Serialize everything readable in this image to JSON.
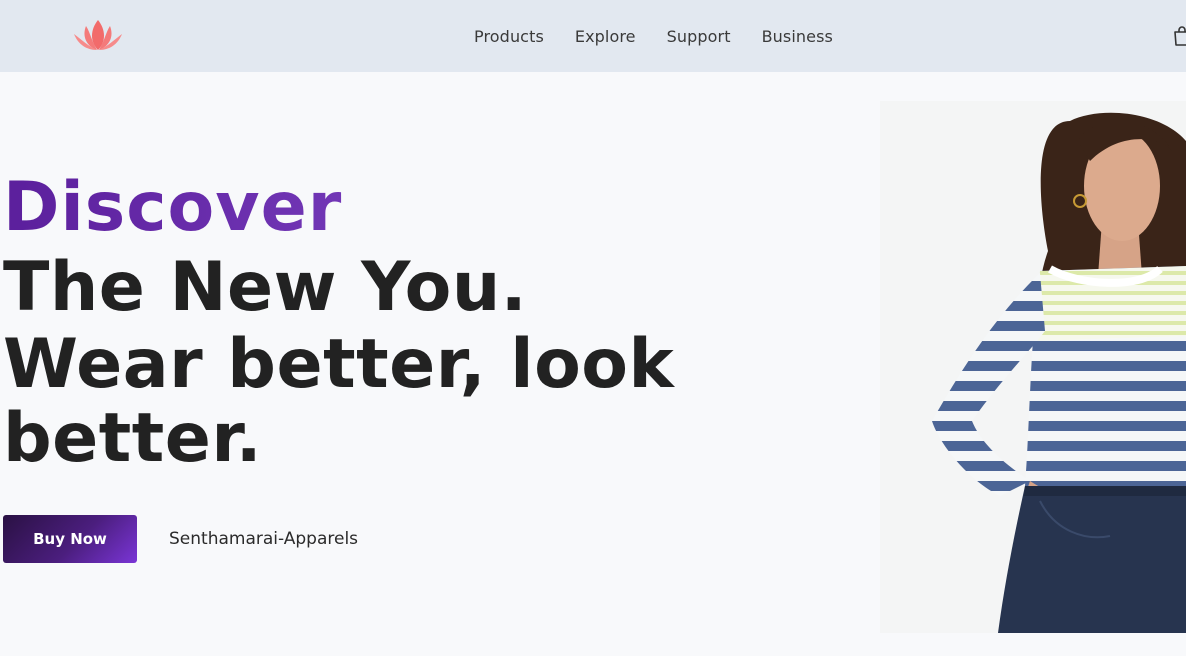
{
  "nav": {
    "logo": "lotus-logo",
    "links": [
      "Products",
      "Explore",
      "Support",
      "Business"
    ],
    "cart_icon": "shopping-bag-icon"
  },
  "hero": {
    "highlight": "Discover",
    "line1": "The New You.",
    "line2": "Wear better, look better.",
    "cta_label": "Buy Now",
    "brand": "Senthamarai-Apparels"
  },
  "colors": {
    "navbar_bg": "#e2e8f0",
    "page_bg": "#f8f9fb",
    "accent_purple": "#6a2bb8",
    "logo_coral": "#f26b6b",
    "text_dark": "#222222"
  }
}
